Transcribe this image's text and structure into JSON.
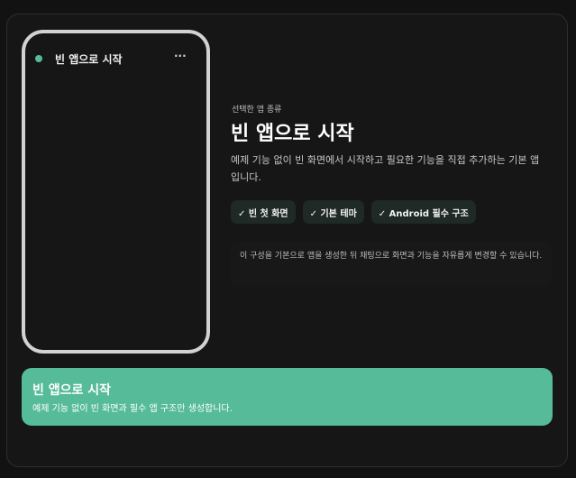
{
  "preview": {
    "title": "빈 앱으로 시작",
    "menu_glyph": "···"
  },
  "detail": {
    "eyebrow": "선택한 앱 종류",
    "title": "빈 앱으로 시작",
    "description": "예제 기능 없이 빈 화면에서 시작하고 필요한 기능을 직접 추가하는 기본 앱입니다.",
    "chips": [
      "✓ 빈 첫 화면",
      "✓ 기본 테마",
      "✓ Android 필수 구조"
    ],
    "note": "이 구성을 기본으로 앱을 생성한 뒤 채팅으로 화면과 기능을 자유롭게 변경할 수 있습니다."
  },
  "cta": {
    "title": "빈 앱으로 시작",
    "subtitle": "예제 기능 없이 빈 화면과 필수 앱 구조만 생성합니다."
  },
  "colors": {
    "accent": "#56bb98",
    "background": "#121212",
    "panel": "#161616",
    "chip_background": "#1f2a26",
    "phone_frame": "#d2d2d2"
  }
}
